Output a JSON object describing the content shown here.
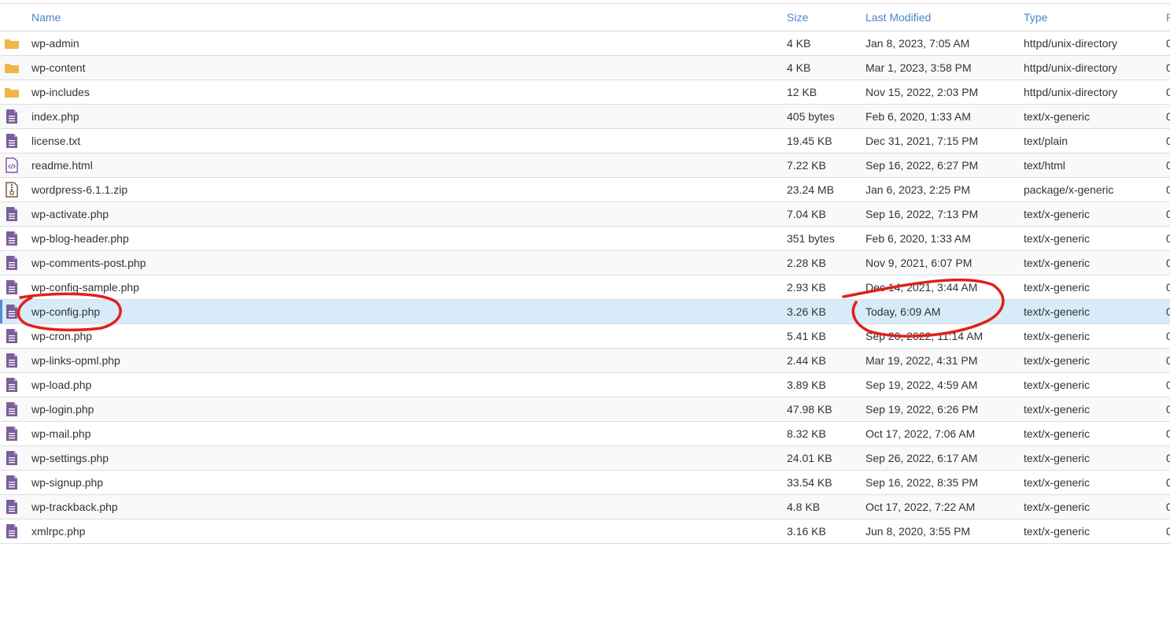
{
  "table": {
    "headers": {
      "name": "Name",
      "size": "Size",
      "modified": "Last Modified",
      "type": "Type",
      "perms": "P"
    },
    "rows": [
      {
        "icon": "folder-icon",
        "name": "wp-admin",
        "size": "4 KB",
        "modified": "Jan 8, 2023, 7:05 AM",
        "type": "httpd/unix-directory",
        "perm": "0"
      },
      {
        "icon": "folder-icon",
        "name": "wp-content",
        "size": "4 KB",
        "modified": "Mar 1, 2023, 3:58 PM",
        "type": "httpd/unix-directory",
        "perm": "0"
      },
      {
        "icon": "folder-icon",
        "name": "wp-includes",
        "size": "12 KB",
        "modified": "Nov 15, 2022, 2:03 PM",
        "type": "httpd/unix-directory",
        "perm": "0"
      },
      {
        "icon": "text-file-icon",
        "name": "index.php",
        "size": "405 bytes",
        "modified": "Feb 6, 2020, 1:33 AM",
        "type": "text/x-generic",
        "perm": "0"
      },
      {
        "icon": "text-file-icon",
        "name": "license.txt",
        "size": "19.45 KB",
        "modified": "Dec 31, 2021, 7:15 PM",
        "type": "text/plain",
        "perm": "0"
      },
      {
        "icon": "html-file-icon",
        "name": "readme.html",
        "size": "7.22 KB",
        "modified": "Sep 16, 2022, 6:27 PM",
        "type": "text/html",
        "perm": "0"
      },
      {
        "icon": "zip-file-icon",
        "name": "wordpress-6.1.1.zip",
        "size": "23.24 MB",
        "modified": "Jan 6, 2023, 2:25 PM",
        "type": "package/x-generic",
        "perm": "0"
      },
      {
        "icon": "text-file-icon",
        "name": "wp-activate.php",
        "size": "7.04 KB",
        "modified": "Sep 16, 2022, 7:13 PM",
        "type": "text/x-generic",
        "perm": "0"
      },
      {
        "icon": "text-file-icon",
        "name": "wp-blog-header.php",
        "size": "351 bytes",
        "modified": "Feb 6, 2020, 1:33 AM",
        "type": "text/x-generic",
        "perm": "0"
      },
      {
        "icon": "text-file-icon",
        "name": "wp-comments-post.php",
        "size": "2.28 KB",
        "modified": "Nov 9, 2021, 6:07 PM",
        "type": "text/x-generic",
        "perm": "0"
      },
      {
        "icon": "text-file-icon",
        "name": "wp-config-sample.php",
        "size": "2.93 KB",
        "modified": "Dec 14, 2021, 3:44 AM",
        "type": "text/x-generic",
        "perm": "0"
      },
      {
        "icon": "text-file-icon",
        "name": "wp-config.php",
        "size": "3.26 KB",
        "modified": "Today, 6:09 AM",
        "type": "text/x-generic",
        "perm": "0",
        "selected": true
      },
      {
        "icon": "text-file-icon",
        "name": "wp-cron.php",
        "size": "5.41 KB",
        "modified": "Sep 20, 2022, 11:14 AM",
        "type": "text/x-generic",
        "perm": "0"
      },
      {
        "icon": "text-file-icon",
        "name": "wp-links-opml.php",
        "size": "2.44 KB",
        "modified": "Mar 19, 2022, 4:31 PM",
        "type": "text/x-generic",
        "perm": "0"
      },
      {
        "icon": "text-file-icon",
        "name": "wp-load.php",
        "size": "3.89 KB",
        "modified": "Sep 19, 2022, 4:59 AM",
        "type": "text/x-generic",
        "perm": "0"
      },
      {
        "icon": "text-file-icon",
        "name": "wp-login.php",
        "size": "47.98 KB",
        "modified": "Sep 19, 2022, 6:26 PM",
        "type": "text/x-generic",
        "perm": "0"
      },
      {
        "icon": "text-file-icon",
        "name": "wp-mail.php",
        "size": "8.32 KB",
        "modified": "Oct 17, 2022, 7:06 AM",
        "type": "text/x-generic",
        "perm": "0"
      },
      {
        "icon": "text-file-icon",
        "name": "wp-settings.php",
        "size": "24.01 KB",
        "modified": "Sep 26, 2022, 6:17 AM",
        "type": "text/x-generic",
        "perm": "0"
      },
      {
        "icon": "text-file-icon",
        "name": "wp-signup.php",
        "size": "33.54 KB",
        "modified": "Sep 16, 2022, 8:35 PM",
        "type": "text/x-generic",
        "perm": "0"
      },
      {
        "icon": "text-file-icon",
        "name": "wp-trackback.php",
        "size": "4.8 KB",
        "modified": "Oct 17, 2022, 7:22 AM",
        "type": "text/x-generic",
        "perm": "0"
      },
      {
        "icon": "text-file-icon",
        "name": "xmlrpc.php",
        "size": "3.16 KB",
        "modified": "Jun 8, 2020, 3:55 PM",
        "type": "text/x-generic",
        "perm": "0"
      }
    ]
  },
  "colors": {
    "header_text": "#4a86c5",
    "selected_row": "#d7ebf9",
    "folder": "#f0b648",
    "file": "#7a5f9a",
    "annotation": "#e0201a"
  }
}
